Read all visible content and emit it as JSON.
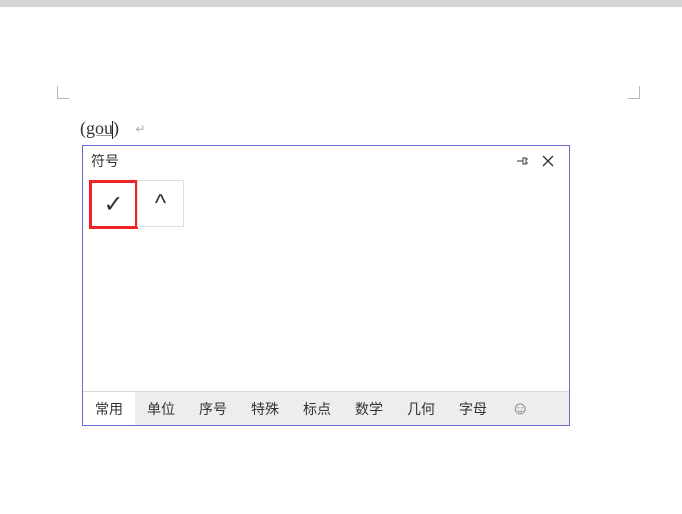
{
  "document": {
    "typed_open": "(",
    "typed_text": "gou",
    "typed_close": ")",
    "trail_glyph": "↵"
  },
  "panel": {
    "title": "符号",
    "symbols": [
      {
        "glyph": "✓",
        "name": "check-mark",
        "highlight": true
      },
      {
        "glyph": "^",
        "name": "caret",
        "highlight": false
      }
    ],
    "tabs": [
      {
        "label": "常用",
        "name": "tab-common",
        "active": true
      },
      {
        "label": "单位",
        "name": "tab-units",
        "active": false
      },
      {
        "label": "序号",
        "name": "tab-numbers",
        "active": false
      },
      {
        "label": "特殊",
        "name": "tab-special",
        "active": false
      },
      {
        "label": "标点",
        "name": "tab-punct",
        "active": false
      },
      {
        "label": "数学",
        "name": "tab-math",
        "active": false
      },
      {
        "label": "几何",
        "name": "tab-geom",
        "active": false
      },
      {
        "label": "字母",
        "name": "tab-letters",
        "active": false
      }
    ],
    "emoji_tab": "☺"
  }
}
